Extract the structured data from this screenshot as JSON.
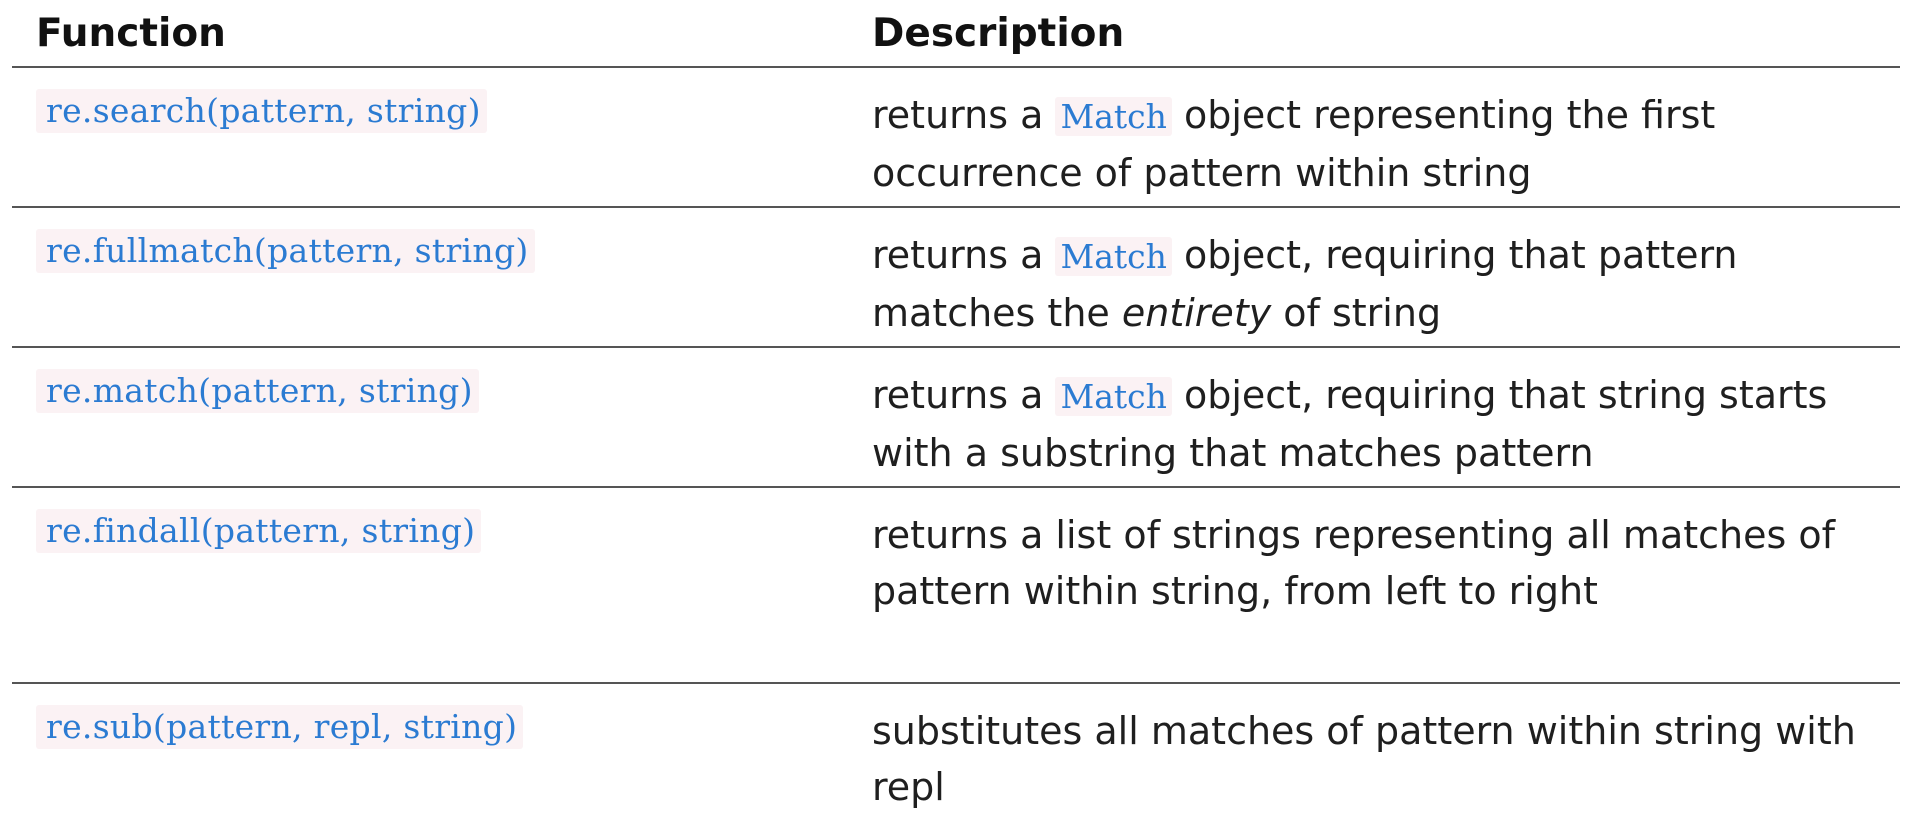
{
  "headers": {
    "function": "Function",
    "description": "Description"
  },
  "rows": [
    {
      "function": "re.search(pattern, string)",
      "desc_pre": "returns a ",
      "desc_code": "Match",
      "desc_post": " object representing the first occurrence of pattern within string",
      "desc_em": "",
      "desc_tail": ""
    },
    {
      "function": "re.fullmatch(pattern, string)",
      "desc_pre": "returns a ",
      "desc_code": "Match",
      "desc_post": " object, requiring that pattern matches the ",
      "desc_em": "entirety",
      "desc_tail": " of string"
    },
    {
      "function": "re.match(pattern, string)",
      "desc_pre": "returns a ",
      "desc_code": "Match",
      "desc_post": " object, requiring that string starts with a substring that matches pattern",
      "desc_em": "",
      "desc_tail": ""
    },
    {
      "function": "re.findall(pattern, string)",
      "desc_pre": "returns a list of strings representing all matches of pattern within string, from left to right",
      "desc_code": "",
      "desc_post": "",
      "desc_em": "",
      "desc_tail": ""
    },
    {
      "function": "re.sub(pattern, repl, string)",
      "desc_pre": "substitutes all matches of pattern within string with repl",
      "desc_code": "",
      "desc_post": "",
      "desc_em": "",
      "desc_tail": ""
    }
  ]
}
